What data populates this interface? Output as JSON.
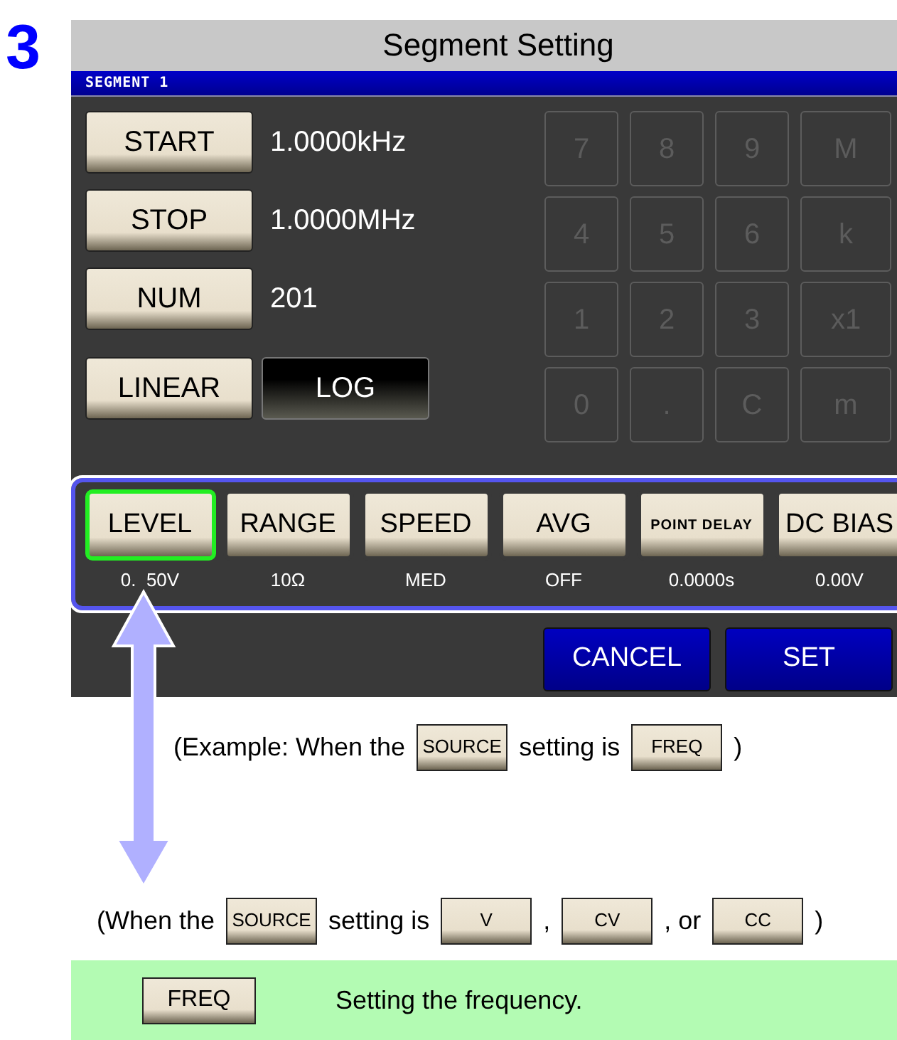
{
  "step": "3",
  "window": {
    "title": "Segment Setting"
  },
  "segment_bar": "SEGMENT 1",
  "fields": [
    {
      "button": "START",
      "value": "1.0000kHz"
    },
    {
      "button": "STOP",
      "value": "1.0000MHz"
    },
    {
      "button": "NUM",
      "value": "201"
    }
  ],
  "sweep_mode": [
    {
      "label": "LINEAR",
      "selected": false
    },
    {
      "label": "LOG",
      "selected": true
    }
  ],
  "keypad": [
    {
      "label": "7",
      "disabled": true
    },
    {
      "label": "8",
      "disabled": true
    },
    {
      "label": "9",
      "disabled": true
    },
    {
      "label": "M",
      "disabled": true
    },
    {
      "label": "4",
      "disabled": true
    },
    {
      "label": "5",
      "disabled": true
    },
    {
      "label": "6",
      "disabled": true
    },
    {
      "label": "k",
      "disabled": true
    },
    {
      "label": "1",
      "disabled": true
    },
    {
      "label": "2",
      "disabled": true
    },
    {
      "label": "3",
      "disabled": true
    },
    {
      "label": "x1",
      "disabled": true
    },
    {
      "label": "0",
      "disabled": true
    },
    {
      "label": ".",
      "disabled": true
    },
    {
      "label": "C",
      "disabled": true
    },
    {
      "label": "m",
      "disabled": true
    }
  ],
  "parameters": [
    {
      "label": "LEVEL",
      "value": "0.  50V",
      "highlighted": true
    },
    {
      "label": "RANGE",
      "value": "10Ω",
      "highlighted": false
    },
    {
      "label": "SPEED",
      "value": "MED",
      "highlighted": false
    },
    {
      "label": "AVG",
      "value": "OFF",
      "highlighted": false
    },
    {
      "label": "POINT DELAY",
      "value": "0.0000s",
      "highlighted": false
    },
    {
      "label": "DC BIAS",
      "value": "0.00V",
      "highlighted": false
    }
  ],
  "actions": [
    {
      "label": "CANCEL"
    },
    {
      "label": "SET"
    }
  ],
  "notes": [
    [
      {
        "kind": "text",
        "text": "(Example: When the"
      },
      {
        "kind": "key",
        "text": "SOURCE"
      },
      {
        "kind": "text",
        "text": "setting is"
      },
      {
        "kind": "key",
        "text": "FREQ"
      },
      {
        "kind": "text",
        "text": ")"
      }
    ],
    [
      {
        "kind": "text",
        "text": "(When the"
      },
      {
        "kind": "key",
        "text": "SOURCE"
      },
      {
        "kind": "text",
        "text": "setting is"
      },
      {
        "kind": "key",
        "text": "V"
      },
      {
        "kind": "text",
        "text": ","
      },
      {
        "kind": "key",
        "text": "CV"
      },
      {
        "kind": "text",
        "text": ", or"
      },
      {
        "kind": "key",
        "text": "CC"
      },
      {
        "kind": "text",
        "text": ")"
      }
    ]
  ],
  "description": {
    "key": "FREQ",
    "text": "Setting the frequency."
  }
}
